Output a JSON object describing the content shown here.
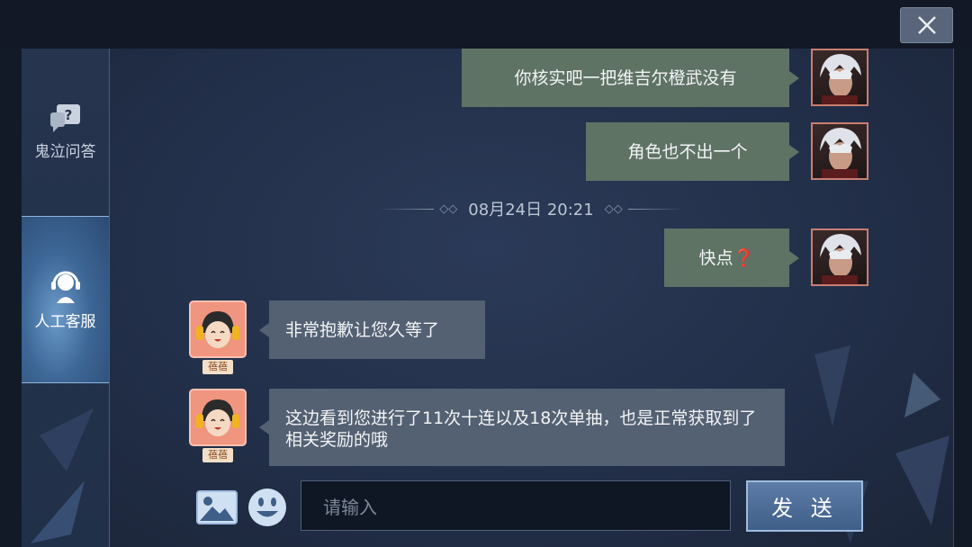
{
  "sidebar": {
    "items": [
      {
        "label": "鬼泣问答",
        "icon": "question-bubbles-icon"
      },
      {
        "label": "人工客服",
        "icon": "headset-agent-icon"
      }
    ]
  },
  "chat": {
    "messages": [
      {
        "sender": "me",
        "text": "你核实吧一把维吉尔橙武没有"
      },
      {
        "sender": "me",
        "text": "角色也不出一个"
      },
      {
        "sender": "me",
        "text": "快点❓"
      },
      {
        "sender": "agent",
        "name": "蓓蓓",
        "text": "非常抱歉让您久等了"
      },
      {
        "sender": "agent",
        "name": "蓓蓓",
        "text": "这边看到您进行了11次十连以及18次单抽，也是正常获取到了相关奖励的哦"
      }
    ],
    "timestamp": "08月24日 20:21"
  },
  "composer": {
    "placeholder": "请输入",
    "send_label": "发 送"
  },
  "colors": {
    "my_bubble": "#5f7365",
    "agent_bubble": "#546173",
    "active_tab": "#3d6796",
    "send_button": "#4f6f9a"
  }
}
